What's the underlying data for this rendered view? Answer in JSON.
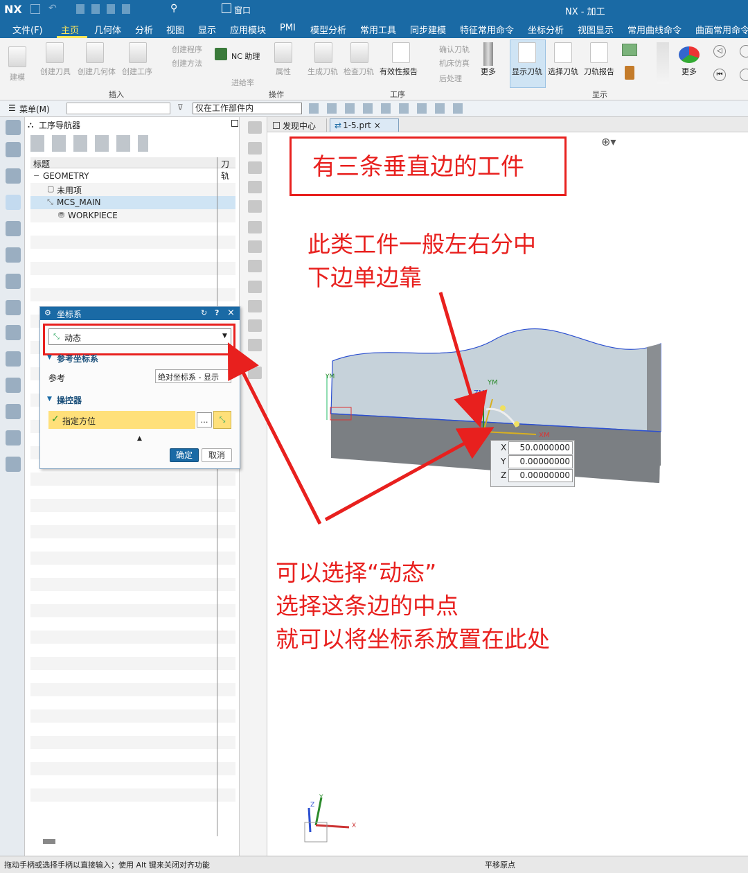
{
  "window": {
    "logo": "NX",
    "title": "NX - 加工",
    "window_menu": "窗口"
  },
  "menubar": [
    "文件(F)",
    "主页",
    "几何体",
    "分析",
    "视图",
    "显示",
    "应用模块",
    "PMI",
    "模型分析",
    "常用工具",
    "同步建模",
    "特征常用命令",
    "坐标分析",
    "视图显示",
    "常用曲线命令",
    "曲面常用命令"
  ],
  "ribbon": {
    "build": "建模",
    "create_tool": "创建刀具",
    "create_geometry": "创建几何体",
    "create_operation": "创建工序",
    "create_program": "创建程序",
    "create_method": "创建方法",
    "nc_assistant": "NC 助理",
    "feature_process": "进给率",
    "properties": "属性",
    "generate_toolpath": "生成刀轨",
    "verify_toolpath": "检查刀轨",
    "validity_report": "有效性报告",
    "confirm_toolpath": "确认刀轨",
    "machine_sim": "机床仿真",
    "post_process": "后处理",
    "more1": "更多",
    "show_toolpath": "显示刀轨",
    "select_toolpath": "选择刀轨",
    "toolpath_report": "刀轨报告",
    "more2": "更多",
    "groups": {
      "insert": "插入",
      "operation": "操作",
      "process": "工序",
      "display": "显示"
    }
  },
  "quickbar": {
    "menu": "菜单(M)",
    "filter": "仅在工作部件内"
  },
  "navigator": {
    "title": "工序导航器",
    "col_title": "标题",
    "col_path": "刀轨",
    "tree": [
      "GEOMETRY",
      "未用项",
      "MCS_MAIN",
      "WORKPIECE"
    ]
  },
  "tabs": {
    "discover": "发现中心",
    "part": "1-5.prt"
  },
  "dialog": {
    "title": "坐标系",
    "type_value": "动态",
    "section_ref": "参考坐标系",
    "ref_label": "参考",
    "ref_value": "绝对坐标系 - 显示",
    "section_manip": "操控器",
    "specify_orient": "指定方位",
    "ok": "确定",
    "cancel": "取消"
  },
  "viewport": {
    "axis_labels": {
      "ym": "YM",
      "zm": "ZM",
      "xm": "XM",
      "y": "Y",
      "z": "Z",
      "x": "X"
    },
    "coords": [
      {
        "label": "X",
        "value": "50.0000000"
      },
      {
        "label": "Y",
        "value": "0.00000000"
      },
      {
        "label": "Z",
        "value": "0.00000000"
      }
    ]
  },
  "annotations": {
    "box_title": "有三条垂直边的工件",
    "note1_line1": "此类工件一般左右分中",
    "note1_line2": "下边单边靠",
    "note2_line1": "可以选择“动态”",
    "note2_line2": "选择这条边的中点",
    "note2_line3": "就可以将坐标系放置在此处"
  },
  "status": {
    "left": "拖动手柄或选择手柄以直接输入；使用 Alt 键来关闭对齐功能",
    "right": "平移原点"
  },
  "colors": {
    "titlebar": "#1a6aa5",
    "annotation": "#e8201e",
    "highlight": "#ffe07a",
    "part_top": "#c4d0d8",
    "part_side": "#7d8185"
  }
}
